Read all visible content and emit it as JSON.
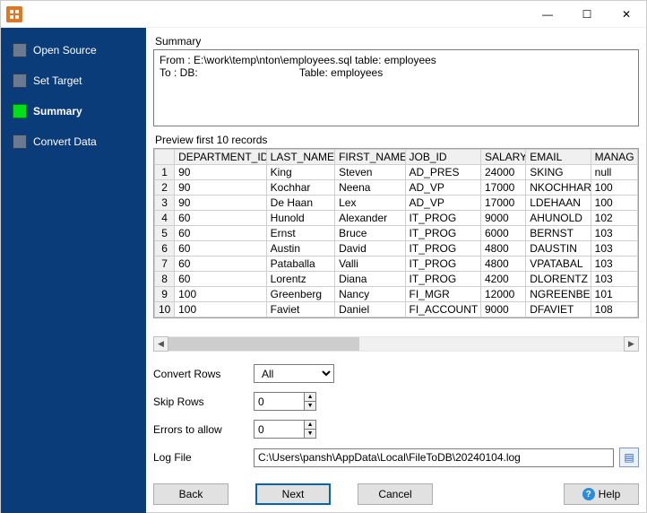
{
  "window": {
    "minimize_glyph": "—",
    "maximize_glyph": "☐",
    "close_glyph": "✕"
  },
  "sidebar": {
    "items": [
      {
        "label": "Open Source"
      },
      {
        "label": "Set Target"
      },
      {
        "label": "Summary"
      },
      {
        "label": "Convert Data"
      }
    ],
    "active_index": 2
  },
  "summary": {
    "heading": "Summary",
    "text": "From : E:\\work\\temp\\nton\\employees.sql table: employees\nTo : DB:                                  Table: employees"
  },
  "preview": {
    "heading": "Preview first 10 records",
    "columns": [
      "DEPARTMENT_ID",
      "LAST_NAME",
      "FIRST_NAME",
      "JOB_ID",
      "SALARY",
      "EMAIL",
      "MANAG"
    ],
    "rows": [
      [
        "90",
        "King",
        "Steven",
        "AD_PRES",
        "24000",
        "SKING",
        "null"
      ],
      [
        "90",
        "Kochhar",
        "Neena",
        "AD_VP",
        "17000",
        "NKOCHHAR",
        "100"
      ],
      [
        "90",
        "De Haan",
        "Lex",
        "AD_VP",
        "17000",
        "LDEHAAN",
        "100"
      ],
      [
        "60",
        "Hunold",
        "Alexander",
        "IT_PROG",
        "9000",
        "AHUNOLD",
        "102"
      ],
      [
        "60",
        "Ernst",
        "Bruce",
        "IT_PROG",
        "6000",
        "BERNST",
        "103"
      ],
      [
        "60",
        "Austin",
        "David",
        "IT_PROG",
        "4800",
        "DAUSTIN",
        "103"
      ],
      [
        "60",
        "Pataballa",
        "Valli",
        "IT_PROG",
        "4800",
        "VPATABAL",
        "103"
      ],
      [
        "60",
        "Lorentz",
        "Diana",
        "IT_PROG",
        "4200",
        "DLORENTZ",
        "103"
      ],
      [
        "100",
        "Greenberg",
        "Nancy",
        "FI_MGR",
        "12000",
        "NGREENBE",
        "101"
      ],
      [
        "100",
        "Faviet",
        "Daniel",
        "FI_ACCOUNT",
        "9000",
        "DFAVIET",
        "108"
      ]
    ]
  },
  "form": {
    "convert_rows": {
      "label": "Convert Rows",
      "value": "All"
    },
    "skip_rows": {
      "label": "Skip Rows",
      "value": "0"
    },
    "errors": {
      "label": "Errors to allow",
      "value": "0"
    },
    "log_file": {
      "label": "Log File",
      "value": "C:\\Users\\pansh\\AppData\\Local\\FileToDB\\20240104.log"
    }
  },
  "buttons": {
    "back": "Back",
    "next": "Next",
    "cancel": "Cancel",
    "help": "Help"
  }
}
